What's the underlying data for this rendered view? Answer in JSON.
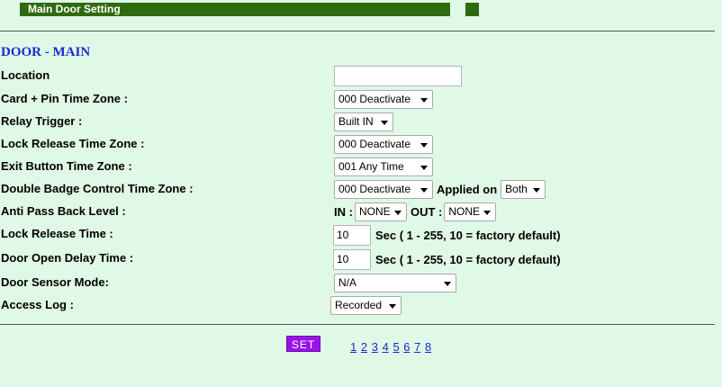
{
  "header": {
    "title": "Main Door Setting"
  },
  "section_title": "DOOR - MAIN",
  "fields": {
    "location": {
      "label": "Location",
      "value": ""
    },
    "card_pin": {
      "label": "Card + Pin Time Zone :",
      "value": "000 Deactivate"
    },
    "relay_trigger": {
      "label": "Relay Trigger :",
      "value": "Built IN"
    },
    "lock_release_tz": {
      "label": "Lock Release Time Zone :",
      "value": "000 Deactivate"
    },
    "exit_button_tz": {
      "label": "Exit Button Time Zone :",
      "value": "001 Any Time"
    },
    "double_badge": {
      "label": "Double Badge Control Time Zone :",
      "value": "000 Deactivate",
      "applied_label": "Applied on",
      "applied_value": "Both"
    },
    "anti_pass_back": {
      "label": "Anti Pass Back Level :",
      "in_label": "IN :",
      "in_value": "NONE",
      "out_label": "OUT :",
      "out_value": "NONE"
    },
    "lock_release_time": {
      "label": "Lock Release Time  :",
      "value": "10",
      "hint": "Sec ( 1 - 255, 10 = factory default)"
    },
    "door_open_delay": {
      "label": "Door Open Delay Time  :",
      "value": "10",
      "hint": "Sec ( 1 - 255, 10 = factory default)"
    },
    "door_sensor_mode": {
      "label": "Door Sensor Mode:",
      "value": "N/A"
    },
    "access_log": {
      "label": "Access Log :",
      "value": "Recorded"
    }
  },
  "actions": {
    "set_label": "SET"
  },
  "pagination": [
    "1",
    "2",
    "3",
    "4",
    "5",
    "6",
    "7",
    "8"
  ]
}
